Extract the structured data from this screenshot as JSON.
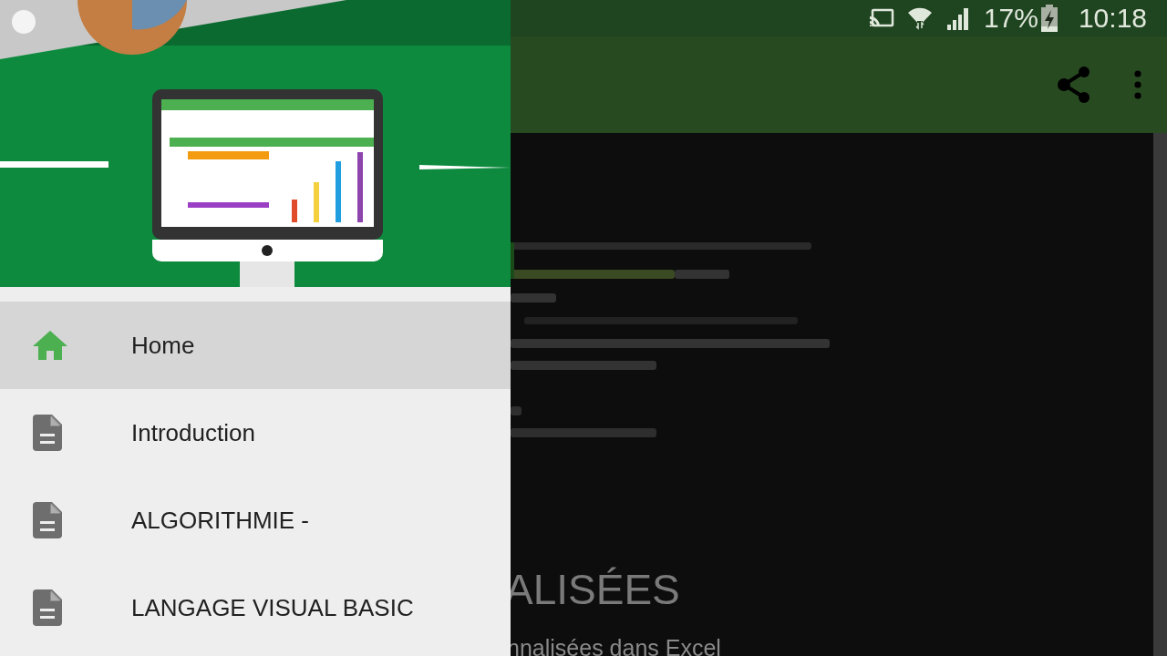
{
  "status_bar": {
    "battery_percent": "17%",
    "time": "10:18"
  },
  "content": {
    "title": "ALISÉES",
    "subtitle": "nnalisées dans Excel"
  },
  "drawer": {
    "items": [
      {
        "label": "Home",
        "kind": "home",
        "selected": true
      },
      {
        "label": "Introduction",
        "kind": "page",
        "selected": false
      },
      {
        "label": "ALGORITHMIE -",
        "kind": "page",
        "selected": false
      },
      {
        "label": "LANGAGE VISUAL BASIC",
        "kind": "page",
        "selected": false
      }
    ]
  }
}
